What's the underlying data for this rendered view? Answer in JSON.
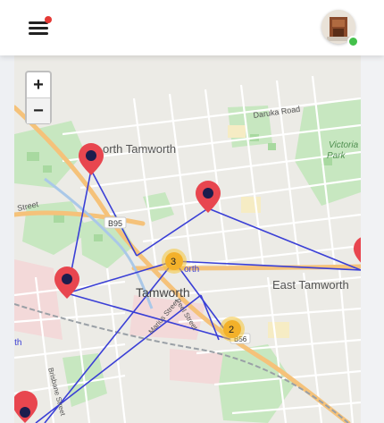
{
  "header": {
    "menu_icon": "hamburger-menu-icon",
    "notification_color": "#e53935",
    "avatar_icon": "user-avatar",
    "online_color": "#43c04a"
  },
  "zoom": {
    "in_label": "+",
    "out_label": "−"
  },
  "map": {
    "place_labels": {
      "north_tamworth": "orth Tamworth",
      "tamworth": "Tamworth",
      "east_tamworth": "East Tamworth",
      "victoria_park_1": "Victoria",
      "victoria_park_2": "Park",
      "orth": "orth",
      "nth_left": "North"
    },
    "street_labels": {
      "daruka": "Daruka Road",
      "street_left": "Street",
      "peel": "Peel Street",
      "brisbane": "Brisbane Street",
      "marius": "Marius Street"
    },
    "road_badges": {
      "b95": "B95",
      "b56": "B56"
    },
    "clusters": [
      {
        "name": "cluster-3",
        "count": "3"
      },
      {
        "name": "cluster-2",
        "count": "2"
      }
    ],
    "route_color": "#3a3fd6",
    "marker_color": "#e8464f"
  }
}
